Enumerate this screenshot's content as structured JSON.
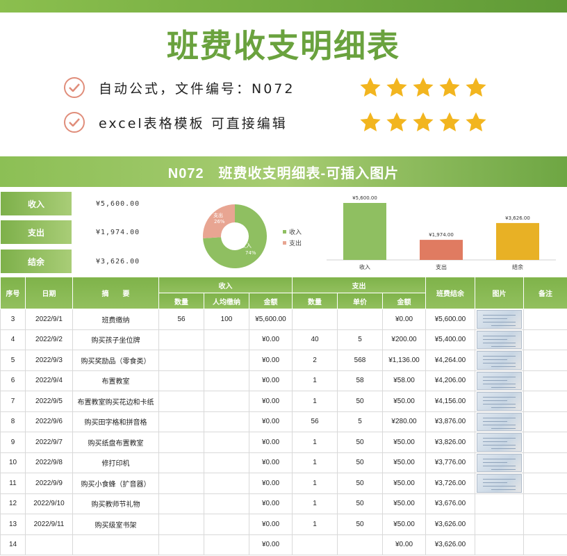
{
  "title": "班费收支明细表",
  "features": [
    {
      "text": "自动公式，文件编号：N072",
      "icon": "check-circle-icon"
    },
    {
      "text": "excel表格模板 可直接编辑",
      "icon": "check-circle-icon"
    }
  ],
  "rating_stars": 5,
  "banner": "N072　班费收支明细表-可插入图片",
  "summary": [
    {
      "label": "收入",
      "value": "¥5,600.00"
    },
    {
      "label": "支出",
      "value": "¥1,974.00"
    },
    {
      "label": "结余",
      "value": "¥3,626.00"
    }
  ],
  "donut": {
    "income_label": "收入",
    "income_pct": "74%",
    "income_share": 74,
    "expense_label": "支出",
    "expense_pct": "26%",
    "expense_share": 26,
    "legend": [
      "收入",
      "支出"
    ]
  },
  "chart_data": {
    "type": "bar",
    "categories": [
      "收入",
      "支出",
      "结余"
    ],
    "values": [
      5600,
      1974,
      3626
    ],
    "data_labels": [
      "¥5,600.00",
      "¥1,974.00",
      "¥3,626.00"
    ],
    "colors": [
      "#8fbf61",
      "#e07b61",
      "#e8b125"
    ]
  },
  "table": {
    "headers": {
      "seq": "序号",
      "date": "日期",
      "summary": "摘　　要",
      "income": "收入",
      "expense": "支出",
      "balance": "班费结余",
      "picture": "图片",
      "remark": "备注",
      "qty": "数量",
      "per_capita": "人均缴纳",
      "amount": "金额",
      "qty2": "数量",
      "unit_price": "单价",
      "amount2": "金额"
    },
    "rows": [
      {
        "seq": "3",
        "date": "2022/9/1",
        "summary": "班费缴纳",
        "in_qty": "56",
        "in_per": "100",
        "in_amt": "¥5,600.00",
        "out_qty": "",
        "out_price": "",
        "out_amt": "¥0.00",
        "balance": "¥5,600.00",
        "has_pic": true
      },
      {
        "seq": "4",
        "date": "2022/9/2",
        "summary": "购买孩子坐位牌",
        "in_qty": "",
        "in_per": "",
        "in_amt": "¥0.00",
        "out_qty": "40",
        "out_price": "5",
        "out_amt": "¥200.00",
        "balance": "¥5,400.00",
        "has_pic": true
      },
      {
        "seq": "5",
        "date": "2022/9/3",
        "summary": "购买奖励品（零食类）",
        "in_qty": "",
        "in_per": "",
        "in_amt": "¥0.00",
        "out_qty": "2",
        "out_price": "568",
        "out_amt": "¥1,136.00",
        "balance": "¥4,264.00",
        "has_pic": true
      },
      {
        "seq": "6",
        "date": "2022/9/4",
        "summary": "布置教室",
        "in_qty": "",
        "in_per": "",
        "in_amt": "¥0.00",
        "out_qty": "1",
        "out_price": "58",
        "out_amt": "¥58.00",
        "balance": "¥4,206.00",
        "has_pic": true
      },
      {
        "seq": "7",
        "date": "2022/9/5",
        "summary": "布置教室购买花边和卡纸",
        "in_qty": "",
        "in_per": "",
        "in_amt": "¥0.00",
        "out_qty": "1",
        "out_price": "50",
        "out_amt": "¥50.00",
        "balance": "¥4,156.00",
        "has_pic": true
      },
      {
        "seq": "8",
        "date": "2022/9/6",
        "summary": "购买田字格和拼音格",
        "in_qty": "",
        "in_per": "",
        "in_amt": "¥0.00",
        "out_qty": "56",
        "out_price": "5",
        "out_amt": "¥280.00",
        "balance": "¥3,876.00",
        "has_pic": true
      },
      {
        "seq": "9",
        "date": "2022/9/7",
        "summary": "购买纸盘布置教室",
        "in_qty": "",
        "in_per": "",
        "in_amt": "¥0.00",
        "out_qty": "1",
        "out_price": "50",
        "out_amt": "¥50.00",
        "balance": "¥3,826.00",
        "has_pic": true
      },
      {
        "seq": "10",
        "date": "2022/9/8",
        "summary": "修打印机",
        "in_qty": "",
        "in_per": "",
        "in_amt": "¥0.00",
        "out_qty": "1",
        "out_price": "50",
        "out_amt": "¥50.00",
        "balance": "¥3,776.00",
        "has_pic": true
      },
      {
        "seq": "11",
        "date": "2022/9/9",
        "summary": "购买小食蜂（扩音器）",
        "in_qty": "",
        "in_per": "",
        "in_amt": "¥0.00",
        "out_qty": "1",
        "out_price": "50",
        "out_amt": "¥50.00",
        "balance": "¥3,726.00",
        "has_pic": true
      },
      {
        "seq": "12",
        "date": "2022/9/10",
        "summary": "购买教师节礼物",
        "in_qty": "",
        "in_per": "",
        "in_amt": "¥0.00",
        "out_qty": "1",
        "out_price": "50",
        "out_amt": "¥50.00",
        "balance": "¥3,676.00",
        "has_pic": false
      },
      {
        "seq": "13",
        "date": "2022/9/11",
        "summary": "购买级室书架",
        "in_qty": "",
        "in_per": "",
        "in_amt": "¥0.00",
        "out_qty": "1",
        "out_price": "50",
        "out_amt": "¥50.00",
        "balance": "¥3,626.00",
        "has_pic": false
      },
      {
        "seq": "14",
        "date": "",
        "summary": "",
        "in_qty": "",
        "in_per": "",
        "in_amt": "¥0.00",
        "out_qty": "",
        "out_price": "",
        "out_amt": "¥0.00",
        "balance": "¥3,626.00",
        "has_pic": false
      }
    ]
  }
}
